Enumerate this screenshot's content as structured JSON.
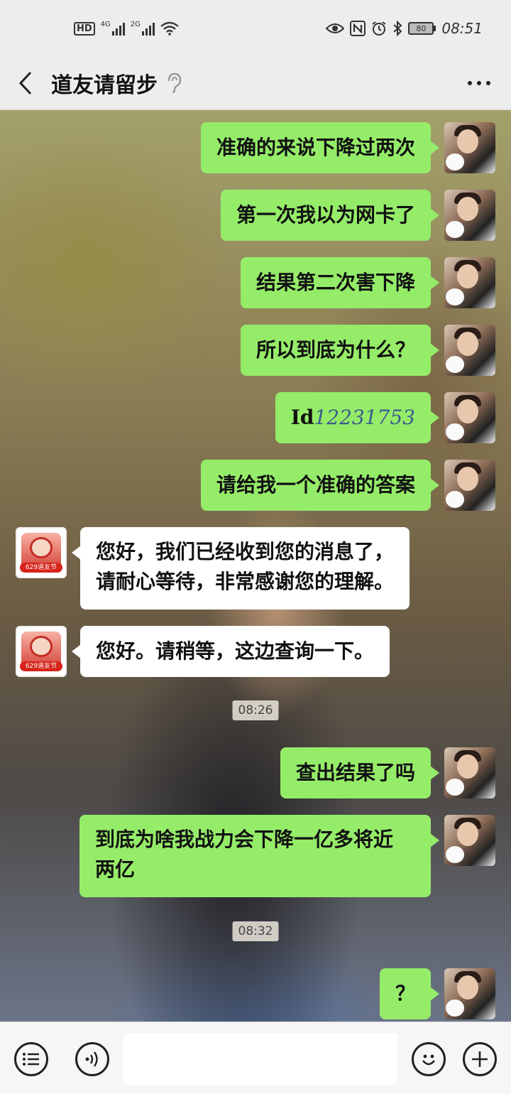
{
  "status_bar": {
    "hd": "HD",
    "sim1": "4G",
    "sim2": "2G",
    "battery": "80",
    "time": "08:51"
  },
  "header": {
    "title": "道友请留步"
  },
  "messages": [
    {
      "from": "me",
      "text": "准确的来说下降过两次"
    },
    {
      "from": "me",
      "text": "第一次我以为网卡了"
    },
    {
      "from": "me",
      "text": "结果第二次害下降"
    },
    {
      "from": "me",
      "text": "所以到底为什么？"
    },
    {
      "from": "me",
      "text_prefix": "Id",
      "text_num": "12231753"
    },
    {
      "from": "me",
      "text": "请给我一个准确的答案"
    },
    {
      "from": "bot",
      "line1": "您好，我们已经收到您的消息了，",
      "line2": "请耐心等待，非常感谢您的理解。"
    },
    {
      "from": "bot",
      "text": "您好。请稍等，这边查询一下。"
    },
    {
      "type": "time",
      "text": "08:26"
    },
    {
      "from": "me",
      "text": "查出结果了吗"
    },
    {
      "from": "me",
      "line1": "到底为啥我战力会下降一亿多将近",
      "line2": "两亿"
    },
    {
      "type": "time",
      "text": "08:32"
    },
    {
      "from": "me",
      "text": "？"
    }
  ],
  "bot_avatar": {
    "tag": "629道友节"
  },
  "input_bar": {
    "placeholder": ""
  }
}
